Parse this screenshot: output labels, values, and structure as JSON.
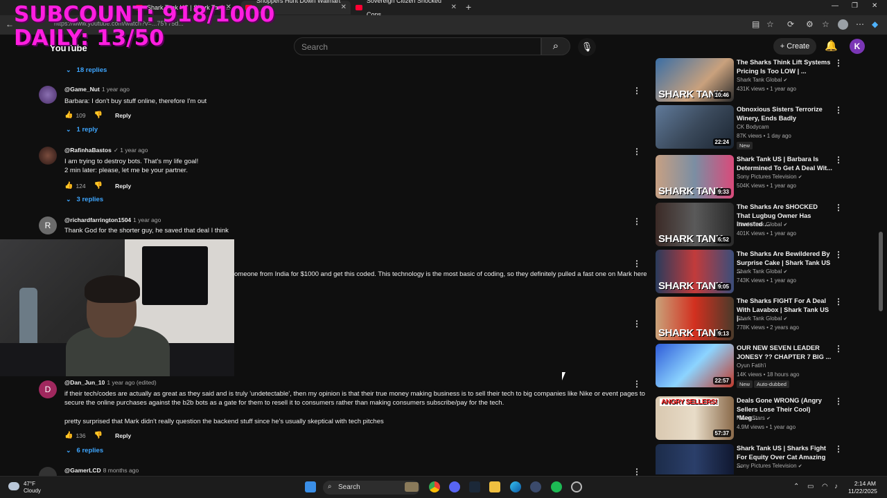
{
  "browser": {
    "tabs": [
      {
        "title": "Shark Tank US | Shark Tank..."
      },
      {
        "title": "Shoppers Hunt Down Walmart K..."
      },
      {
        "title": "Sovereign Citizen Shocked Cops..."
      }
    ],
    "url": "https://www.youtube.com/watch?v=...75Y75d..."
  },
  "overlay": {
    "subcount": "SUBCOUNT: 918/1000",
    "daily": "DAILY: 13/50"
  },
  "youtube": {
    "logo_text": "YouTube",
    "search_placeholder": "Search",
    "create_label": "Create",
    "user_initial": "K"
  },
  "comments": [
    {
      "replies": "18 replies"
    },
    {
      "author": "@Game_Nut",
      "time": "1 year ago",
      "text": "Barbara: I don't buy stuff online, therefore I'm out",
      "likes": "109",
      "reply_label": "Reply",
      "replies": "1 reply"
    },
    {
      "author": "@RafinhaBastos",
      "time": "1 year ago",
      "text1": "I am trying to destroy bots. That's my life goal!",
      "text2": "2 min later: please, let me be your partner.",
      "likes": "124",
      "reply_label": "Reply",
      "replies": "3 replies"
    },
    {
      "author": "@richardfarrington1504",
      "time": "1 year ago",
      "initial": "R",
      "text": "Thank God for the shorter guy, he saved that deal I think"
    },
    {
      "text": "omeone from India for $1000 and get this coded. This technology is the most basic of coding, so they definitely pulled a fast one on Mark here"
    },
    {
      "author": "@Dan_Jun_10",
      "time": "1 year ago (edited)",
      "initial": "D",
      "text1": "if their tech/codes are actually as great as they said and is truly 'undetectable',  then my opinion is that their true money making business is to sell their tech to big companies like Nike or event pages to",
      "text2": "secure the online purchases against the b2b bots as a gate for them to resell it to consumers rather than making consumers subscribe/pay for the tech.",
      "text3": "pretty surprised that Mark didn't really question the backend stuff since he's usually skeptical with tech pitches",
      "likes": "136",
      "reply_label": "Reply",
      "replies": "6 replies"
    },
    {
      "author": "@GamerLCD",
      "time": "8 months ago"
    }
  ],
  "sidebar": [
    {
      "title": "The Sharks Think Lift Systems Pricing Is Too LOW | ...",
      "channel": "Shark Tank Global",
      "meta": "431K views • 1 year ago",
      "duration": "10:46",
      "brand": "SHARK TANK"
    },
    {
      "title": "Obnoxious Sisters Terrorize Winery, Ends Badly",
      "channel": "CK Bodycam",
      "meta": "87K views • 1 day ago",
      "duration": "22:24",
      "badge": "New"
    },
    {
      "title": "Shark Tank US | Barbara Is Determined To Get A Deal Wit...",
      "channel": "Sony Pictures Television",
      "meta": "504K views • 1 year ago",
      "duration": "9:33",
      "brand": "SHARK TANK"
    },
    {
      "title": "The Sharks Are SHOCKED That Lugbug Owner Has Invested ...",
      "channel": "Shark Tank Global",
      "meta": "401K views • 1 year ago",
      "duration": "6:52",
      "brand": "SHARK TANK"
    },
    {
      "title": "The Sharks Are Bewildered By Surprise Cake | Shark Tank US ...",
      "channel": "Shark Tank Global",
      "meta": "743K views • 1 year ago",
      "duration": "9:05",
      "brand": "SHARK TANK"
    },
    {
      "title": "The Sharks FIGHT For A Deal With Lavabox | Shark Tank US |...",
      "channel": "Shark Tank Global",
      "meta": "778K views • 2 years ago",
      "duration": "9:13",
      "brand": "SHARK TANK"
    },
    {
      "title": "OUR NEW SEVEN LEADER JONESY ?? CHAPTER 7 BIG ...",
      "channel": "Oyun Fatih'i",
      "meta": "14K views • 18 hours ago",
      "duration": "22:57",
      "badge": "New",
      "badge2": "Auto-dubbed"
    },
    {
      "title": "Deals Gone WRONG (Angry Sellers Lose Their Cool) *Meg...",
      "channel": "Pawn Stars",
      "meta": "4.9M views • 1 year ago",
      "duration": "57:37",
      "brand": "ANGRY SELLERS!"
    },
    {
      "title": "Shark Tank US | Sharks Fight For Equity Over Cat Amazing ...",
      "channel": "Sony Pictures Television",
      "meta": "",
      "duration": ""
    }
  ],
  "taskbar": {
    "temp": "47°F",
    "weather": "Cloudy",
    "search": "Search",
    "time": "2:14 AM",
    "date": "11/22/2025"
  }
}
